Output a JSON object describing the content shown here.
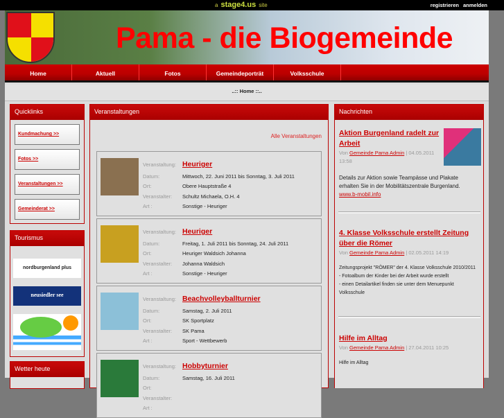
{
  "topbar": {
    "prefix": "a",
    "brand": "stage4.us",
    "suffix": "site",
    "register": "registrieren",
    "login": "anmelden"
  },
  "banner": {
    "title": "Pama - die Biogemeinde"
  },
  "nav": [
    "Home",
    "Aktuell",
    "Fotos",
    "Gemeindeporträt",
    "Volksschule"
  ],
  "breadcrumb": "..:: Home ::..",
  "quicklinks": {
    "title": "Quicklinks",
    "items": [
      "Kundmachung >>",
      "Fotos >>",
      "Veranstaltungen >>",
      "Gemeinderat >>"
    ]
  },
  "tourismus": {
    "title": "Tourismus",
    "logos": [
      "nordburgenland plus",
      "neusiedler see",
      "trees-logo"
    ]
  },
  "wetter": {
    "title": "Wetter heute"
  },
  "events": {
    "title": "Veranstaltungen",
    "all_link": "Alle Veranstaltungen",
    "labels": {
      "event": "Veranstaltung:",
      "date": "Datum:",
      "place": "Ort:",
      "organizer": "Veranstalter:",
      "type": "Art :"
    },
    "items": [
      {
        "name": "Heuriger",
        "date": "Mittwoch, 22. Juni 2011 bis Sonntag, 3. Juli 2011",
        "place": "Obere Hauptstraße 4",
        "organizer": "Schultz Michaela, O.H. 4",
        "type": "Sonstige - Heuriger",
        "color": "#8a7050"
      },
      {
        "name": "Heuriger",
        "date": "Freitag, 1. Juli 2011 bis Sonntag, 24. Juli 2011",
        "place": "Heuriger Waldsich Johanna",
        "organizer": "Johanna Waldsich",
        "type": "Sonstige - Heuriger",
        "color": "#c8a020"
      },
      {
        "name": "Beachvolleyballturnier",
        "date": "Samstag, 2. Juli 2011",
        "place": "SK Sportplatz",
        "organizer": "SK Pama",
        "type": "Sport - Wettbewerb",
        "color": "#8cc0d8"
      },
      {
        "name": "Hobbyturnier",
        "date": "Samstag, 16. Juli 2011",
        "place": "",
        "organizer": "",
        "type": "",
        "color": "#2a7a3a"
      }
    ]
  },
  "news": {
    "title": "Nachrichten",
    "by": "Von",
    "author": "Gemeinde Pama Admin",
    "items": [
      {
        "title": "Aktion Burgenland radelt zur Arbeit",
        "date": "04.05.2011 13:58",
        "text": "Details zur Aktion sowie Teampässe und Plakate erhalten Sie in  der Mobilitätszentrale Burgenland.",
        "link": "www.b-mobil.info"
      },
      {
        "title": "4. Klasse Volksschule erstellt Zeitung über die Römer",
        "date": "02.05.2011 14:19",
        "lines": [
          "Zeitungsprojekt \"RÖMER\" der 4. Klasse Volksschule 2010/2011",
          "- Fotoalbum der Kinder bei der Arbeit wurde erstellt",
          "- einen Detailartikel finden sie unter dem Menuepunkt Volksschule"
        ]
      },
      {
        "title": "Hilfe im Alltag",
        "date": "27.04.2011 10:25",
        "text": "Hilfe im Alltag"
      }
    ]
  }
}
